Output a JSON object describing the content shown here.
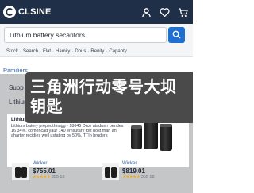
{
  "header": {
    "brand": "CLSINE",
    "icons": [
      "user-icon",
      "favorites-icon",
      "cart-icon"
    ],
    "bg_color": "#1f2f48"
  },
  "search": {
    "value": "Lithium battery secaritors",
    "button_icon": "search-icon",
    "button_color": "#1e6fd0"
  },
  "nav": {
    "items": [
      "Stock",
      "Search",
      "Flat",
      "Hamily",
      "Dous",
      "Renity",
      "Capanty"
    ],
    "separator": "·"
  },
  "main": {
    "section_label": "Pamiliers",
    "supplier_label": "Supp",
    "headline": "Lithium Battery Secaritors"
  },
  "card": {
    "title": "Lithium batery",
    "description": "Lithium batery prepeuthnagg - 18645 Drce atadns r pendes 16 34%. comencad yaur 140 emsutary fort bost man an aharter recidies well ustating by 50%, TTIh bruders"
  },
  "products": [
    {
      "brand": "Wicker",
      "price": "$755.01",
      "stars": "★★★★★",
      "rating_text": "355 18"
    },
    {
      "brand": "Wicker",
      "price": "$819.01",
      "stars": "★★★★★",
      "rating_text": "355 18"
    }
  ],
  "popup": {
    "text": "三角洲行动零号大坝钥匙"
  }
}
